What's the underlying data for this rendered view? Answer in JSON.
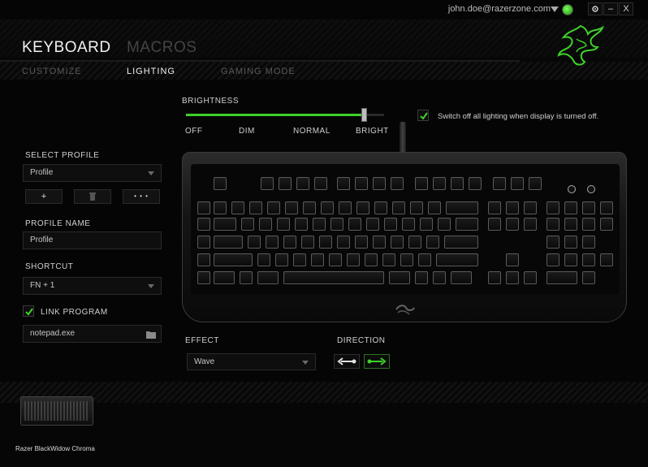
{
  "topbar": {
    "email": "john.doe@razerzone.com",
    "settings_icon": "gear-icon",
    "minimize_label": "–",
    "close_label": "X"
  },
  "header": {
    "main_tabs": [
      "KEYBOARD",
      "MACROS"
    ],
    "sub_tabs": [
      "CUSTOMIZE",
      "LIGHTING",
      "GAMING MODE"
    ],
    "active_main": "KEYBOARD",
    "active_sub": "LIGHTING"
  },
  "left": {
    "select_profile_label": "SELECT PROFILE",
    "profile_value": "Profile",
    "add_label": "+",
    "delete_icon": "trash-icon",
    "more_label": "• • •",
    "profile_name_label": "PROFILE NAME",
    "profile_name_value": "Profile",
    "shortcut_label": "SHORTCUT",
    "shortcut_value": "FN + 1",
    "link_program_label": "LINK PROGRAM",
    "link_program_checked": true,
    "program_value": "notepad.exe"
  },
  "lighting": {
    "brightness_label": "BRIGHTNESS",
    "brightness_level": 0.9,
    "ticks": [
      "OFF",
      "DIM",
      "NORMAL",
      "BRIGHT"
    ],
    "switch_off_label": "Switch off all lighting when display is turned off.",
    "switch_off_checked": true,
    "effect_label": "EFFECT",
    "effect_value": "Wave",
    "direction_label": "DIRECTION"
  },
  "device": {
    "name": "Razer BlackWidow Chroma"
  },
  "colors": {
    "accent": "#3fd12a",
    "text": "#cfcfcf",
    "bg": "#050505"
  }
}
